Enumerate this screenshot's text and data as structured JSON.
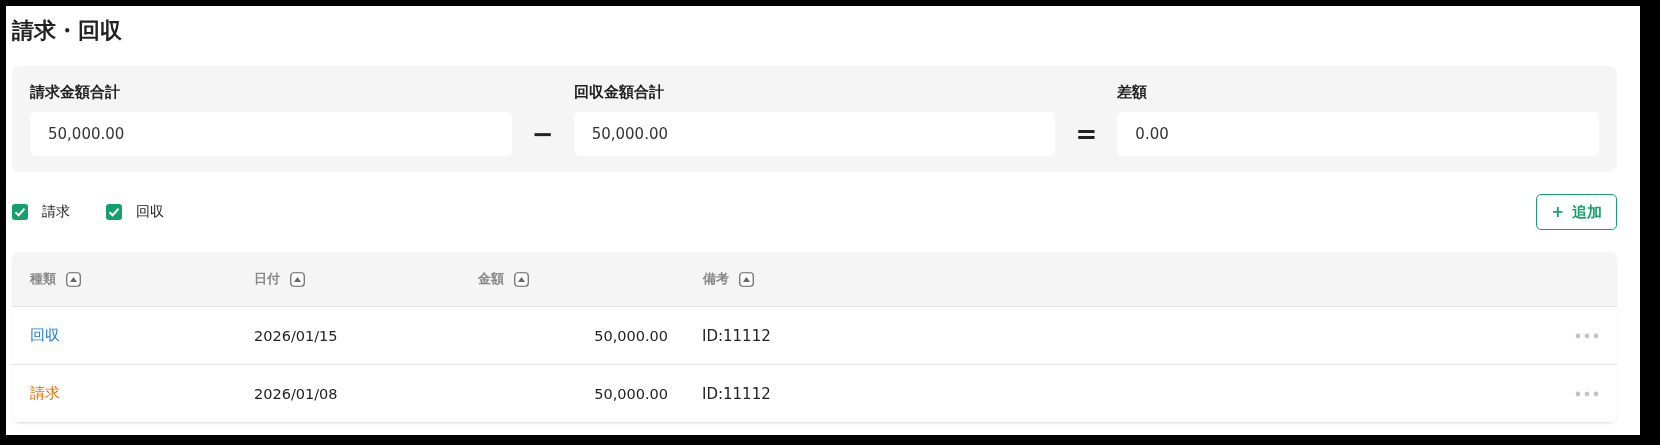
{
  "title": "請求・回収",
  "summary": {
    "fields": [
      {
        "label": "請求金額合計",
        "value": "50,000.00"
      },
      {
        "operator": "−",
        "label": "回収金額合計",
        "value": "50,000.00"
      },
      {
        "operator": "=",
        "label": "差額",
        "value": "0.00"
      }
    ]
  },
  "filters": [
    {
      "label": "請求",
      "checked": true
    },
    {
      "label": "回収",
      "checked": true
    }
  ],
  "add_button": {
    "icon": "+",
    "label": "追加"
  },
  "table": {
    "columns": [
      {
        "label": "種類"
      },
      {
        "label": "日付"
      },
      {
        "label": "金額"
      },
      {
        "label": "備考"
      }
    ],
    "rows": [
      {
        "kind": "collection",
        "type": "回収",
        "date": "2026/01/15",
        "amount": "50,000.00",
        "note": "ID:11112"
      },
      {
        "kind": "billing",
        "type": "請求",
        "date": "2026/01/08",
        "amount": "50,000.00",
        "note": "ID:11112"
      }
    ]
  }
}
